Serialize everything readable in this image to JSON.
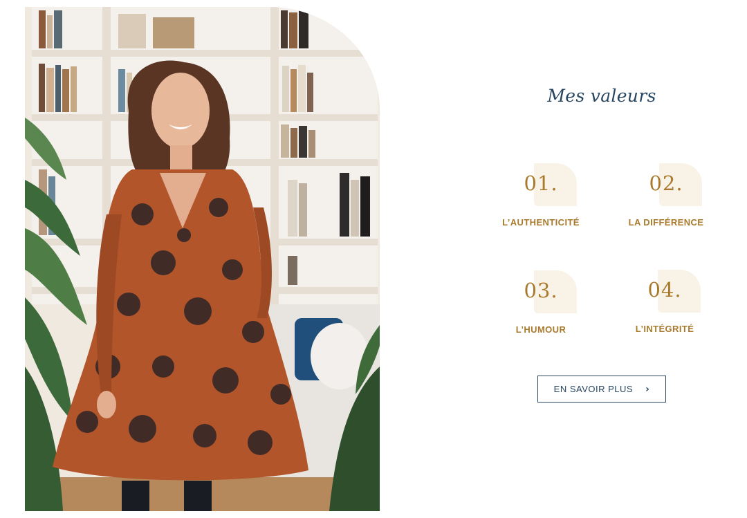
{
  "section": {
    "title": "Mes valeurs",
    "values": [
      {
        "number": "01.",
        "label": "L’AUTHENTICITÉ"
      },
      {
        "number": "02.",
        "label": "LA DIFFÉRENCE"
      },
      {
        "number": "03.",
        "label": "L’HUMOUR"
      },
      {
        "number": "04.",
        "label": "L’INTÉGRITÉ"
      }
    ],
    "cta_label": "EN SAVOIR PLUS",
    "cta_icon": "chevron-right-icon"
  },
  "colors": {
    "navy": "#27455f",
    "gold": "#a97a2c",
    "petal": "#f9f2e7"
  }
}
